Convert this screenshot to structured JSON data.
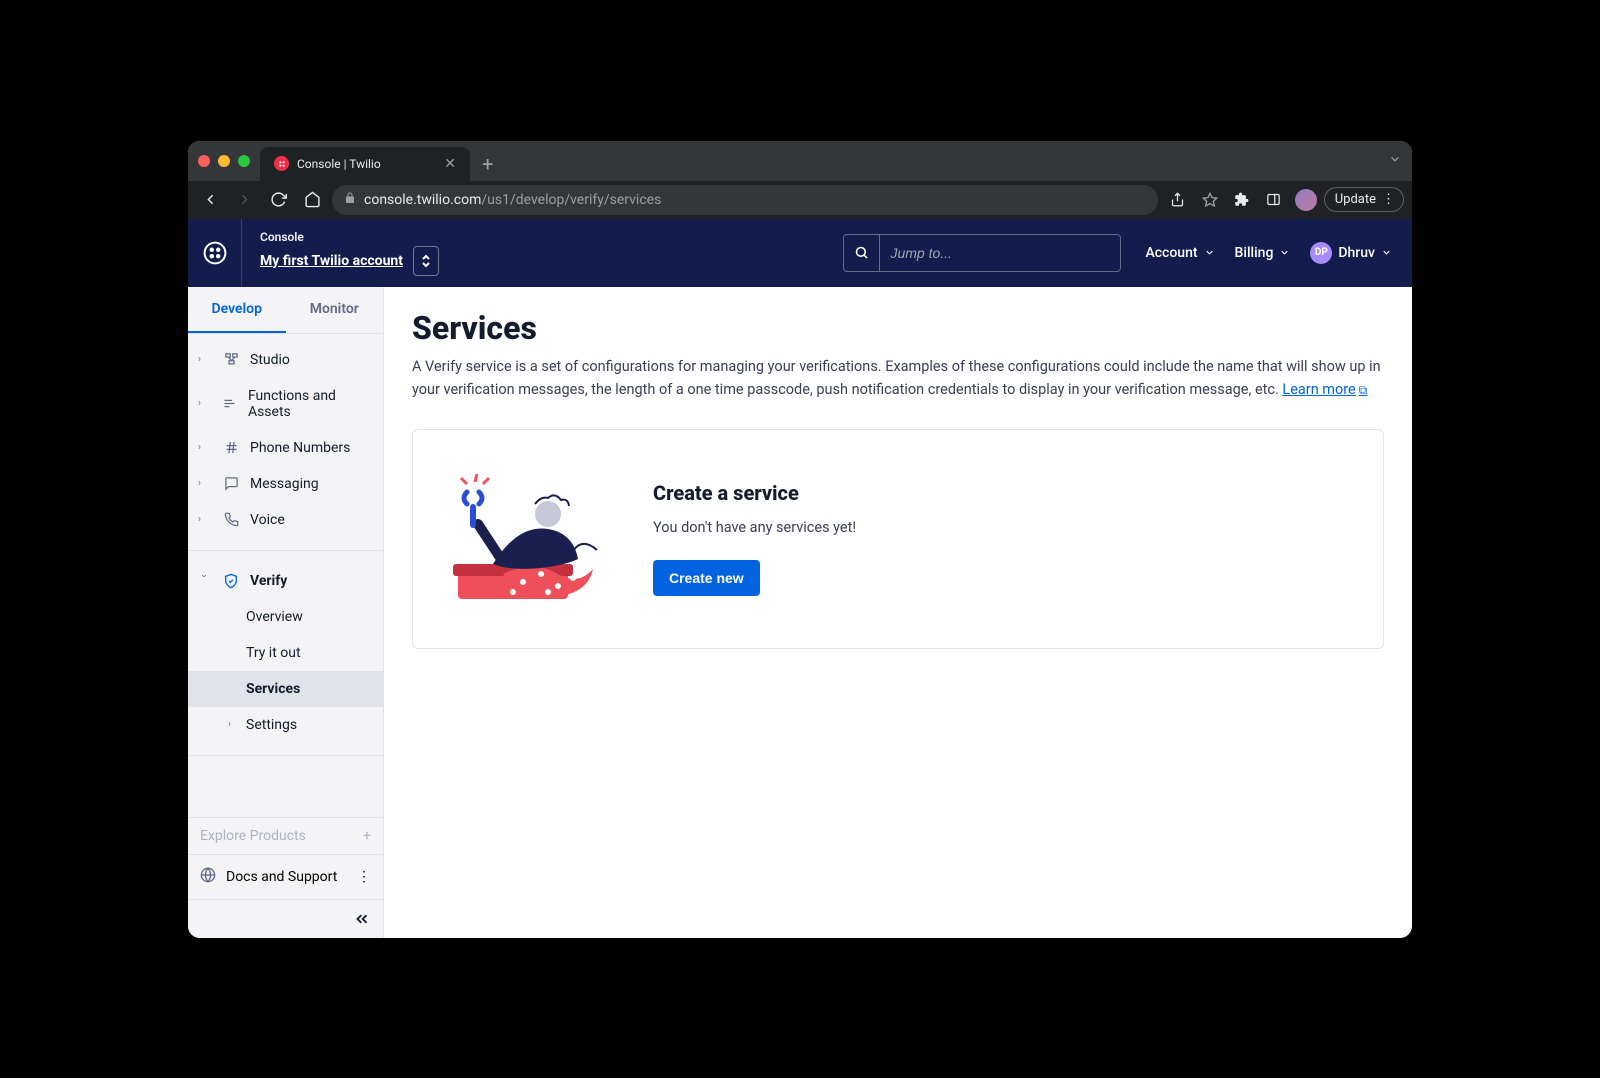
{
  "browser": {
    "tab_title": "Console | Twilio",
    "url_host": "console.twilio.com",
    "url_path": "/us1/develop/verify/services",
    "update_label": "Update"
  },
  "topnav": {
    "console_label": "Console",
    "account_name": "My first Twilio account",
    "search_placeholder": "Jump to...",
    "account_menu": "Account",
    "billing_menu": "Billing",
    "user_initials": "DP",
    "user_name": "Dhruv"
  },
  "sidebar": {
    "tabs": {
      "develop": "Develop",
      "monitor": "Monitor"
    },
    "items": [
      {
        "label": "Studio"
      },
      {
        "label": "Functions and Assets"
      },
      {
        "label": "Phone Numbers"
      },
      {
        "label": "Messaging"
      },
      {
        "label": "Voice"
      }
    ],
    "verify": {
      "label": "Verify",
      "children": {
        "overview": "Overview",
        "tryit": "Try it out",
        "services": "Services",
        "settings": "Settings"
      }
    },
    "explore": "Explore Products",
    "docs": "Docs and Support"
  },
  "page": {
    "title": "Services",
    "description": "A Verify service is a set of configurations for managing your verifications. Examples of these configurations could include the name that will show up in your verification messages, the length of a one time passcode, push notification credentials to display in your verification message, etc. ",
    "learn_more": "Learn more",
    "card_title": "Create a service",
    "card_body": "You don't have any services yet!",
    "create_button": "Create new"
  }
}
